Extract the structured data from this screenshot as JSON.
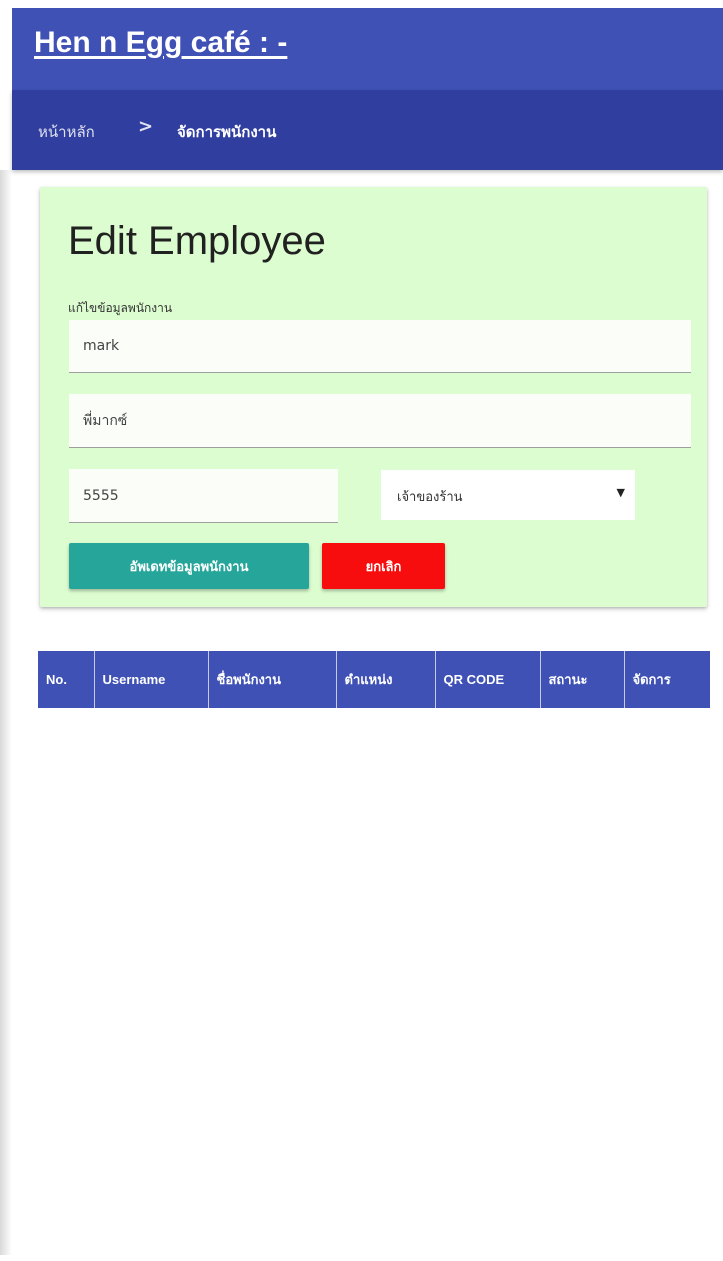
{
  "header": {
    "title": "Hen n Egg café : -"
  },
  "breadcrumb": {
    "home": "หน้าหลัก",
    "separator": ">",
    "current": "จัดการพนักงาน"
  },
  "edit_form": {
    "title": "Edit Employee",
    "section_label": "แก้ไขข้อมูลพนักงาน",
    "username_value": "mark",
    "name_value": "พี่มากซ์",
    "password_value": "5555",
    "position_selected": "เจ้าของร้าน",
    "update_button": "อัพเดทข้อมูลพนักงาน",
    "cancel_button": "ยกเลิก"
  },
  "table": {
    "headers": [
      "No.",
      "Username",
      "ชื่อพนักงาน",
      "ตำแหน่ง",
      "QR CODE",
      "สถานะ",
      "จัดการ"
    ]
  },
  "colors": {
    "header_bg": "#3f51b5",
    "breadcrumb_bg": "#303f9f",
    "card_bg": "#dcfdd0",
    "update_button": "#26a69a",
    "cancel_button": "#f70d0d"
  }
}
